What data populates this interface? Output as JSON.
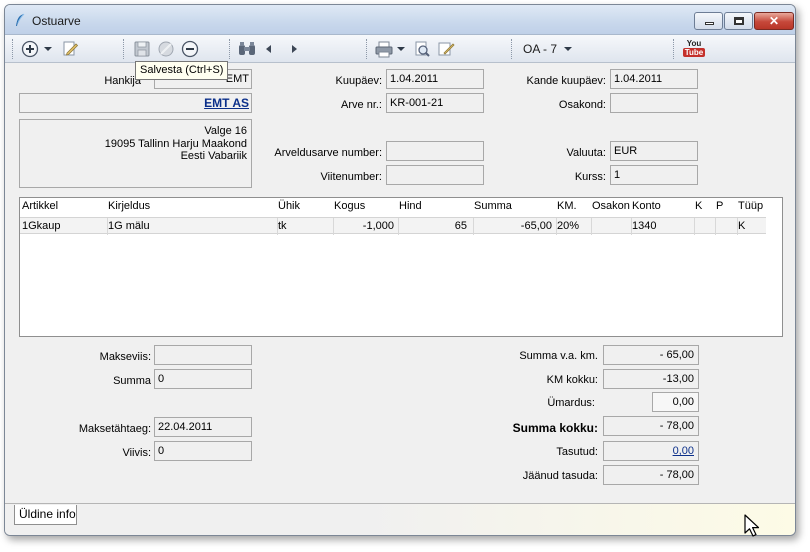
{
  "window": {
    "title": "Ostuarve"
  },
  "toolbar": {
    "doc_type": "OA - 7",
    "tooltip": "Salvesta (Ctrl+S)",
    "youtube_label_top": "You",
    "youtube_label_bottom": "Tube"
  },
  "supplier": {
    "label": "Hankija",
    "code": "EMT",
    "name": "EMT AS",
    "address_line1": "Valge 16",
    "address_line2": "19095 Tallinn Harju Maakond",
    "address_line3": "Eesti Vabariik"
  },
  "header": {
    "date_label": "Kuupäev:",
    "date": "1.04.2011",
    "invoice_no_label": "Arve nr.:",
    "invoice_no": "KR-001-21",
    "account_no_label": "Arveldusarve number:",
    "account_no": "",
    "ref_no_label": "Viitenumber:",
    "ref_no": "",
    "entry_date_label": "Kande kuupäev:",
    "entry_date": "1.04.2011",
    "department_label": "Osakond:",
    "department": "",
    "currency_label": "Valuuta:",
    "currency": "EUR",
    "rate_label": "Kurss:",
    "rate": "1"
  },
  "grid": {
    "columns": [
      "Artikkel",
      "Kirjeldus",
      "Ühik",
      "Kogus",
      "Hind",
      "Summa",
      "KM.",
      "Osakon",
      "Konto",
      "K",
      "P",
      "Tüüp"
    ],
    "rows": [
      [
        "1Gkaup",
        "1G mälu",
        "tk",
        "-1,000",
        "65",
        "-65,00",
        "20%",
        "",
        "1340",
        "",
        "",
        "K"
      ]
    ]
  },
  "payment": {
    "method_label": "Makseviis:",
    "method": "",
    "sum_label": "Summa",
    "sum": "0",
    "due_label": "Maksetähtaeg:",
    "due": "22.04.2011",
    "penalty_label": "Viivis:",
    "penalty": "0"
  },
  "totals": {
    "net_label": "Summa v.a. km.",
    "net": "- 65,00",
    "vat_label": "KM kokku:",
    "vat": "-13,00",
    "rounding_label": "Ümardus:",
    "rounding": "0,00",
    "total_label": "Summa kokku:",
    "total": "- 78,00",
    "paid_label": "Tasutud:",
    "paid": "0,00",
    "remaining_label": "Jäänud tasuda:",
    "remaining": "- 78,00"
  },
  "tabs": {
    "general": "Üldine info"
  },
  "colors": {
    "link": "#0b2f8a",
    "title_bar": "#c9d8ec",
    "close_button": "#c6483a"
  }
}
